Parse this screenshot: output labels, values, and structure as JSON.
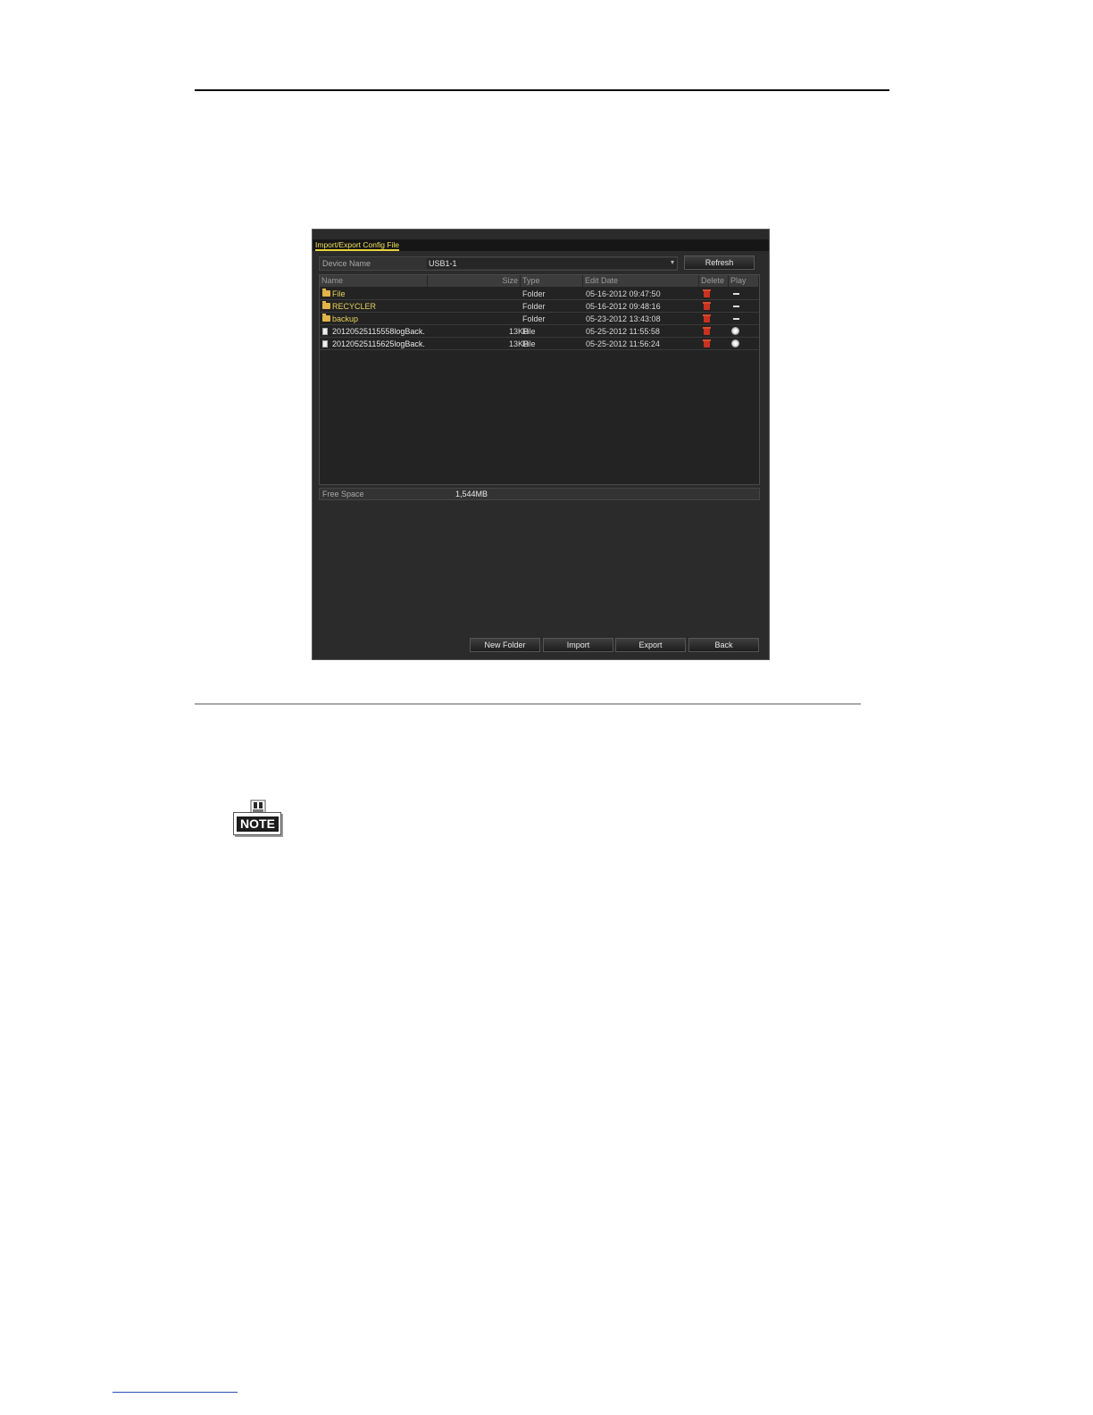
{
  "dialog": {
    "title": "Import/Export Config File",
    "device_label": "Device Name",
    "device_value": "USB1-1",
    "refresh_label": "Refresh",
    "columns": {
      "name": "Name",
      "size": "Size",
      "type": "Type",
      "date": "Edit Date",
      "delete": "Delete",
      "play": "Play"
    },
    "rows": [
      {
        "name": "File",
        "size": "",
        "type": "Folder",
        "date": "05-16-2012 09:47:50",
        "kind": "folder"
      },
      {
        "name": "RECYCLER",
        "size": "",
        "type": "Folder",
        "date": "05-16-2012 09:48:16",
        "kind": "folder"
      },
      {
        "name": "backup",
        "size": "",
        "type": "Folder",
        "date": "05-23-2012 13:43:08",
        "kind": "folder"
      },
      {
        "name": "20120525115558logBack.",
        "size": "13KB",
        "type": "File",
        "date": "05-25-2012 11:55:58",
        "kind": "file"
      },
      {
        "name": "20120525115625logBack.",
        "size": "13KB",
        "type": "File",
        "date": "05-25-2012 11:56:24",
        "kind": "file"
      }
    ],
    "free_space_label": "Free Space",
    "free_space_value": "1,544MB",
    "buttons": {
      "new_folder": "New Folder",
      "import": "Import",
      "export": "Export",
      "back": "Back"
    }
  },
  "note": {
    "label": "NOTE"
  },
  "colors": {
    "title_accent": "#e8d23a",
    "folder_text": "#e8d25a",
    "delete_icon": "#c8321e",
    "dialog_bg": "#2b2b2b"
  }
}
